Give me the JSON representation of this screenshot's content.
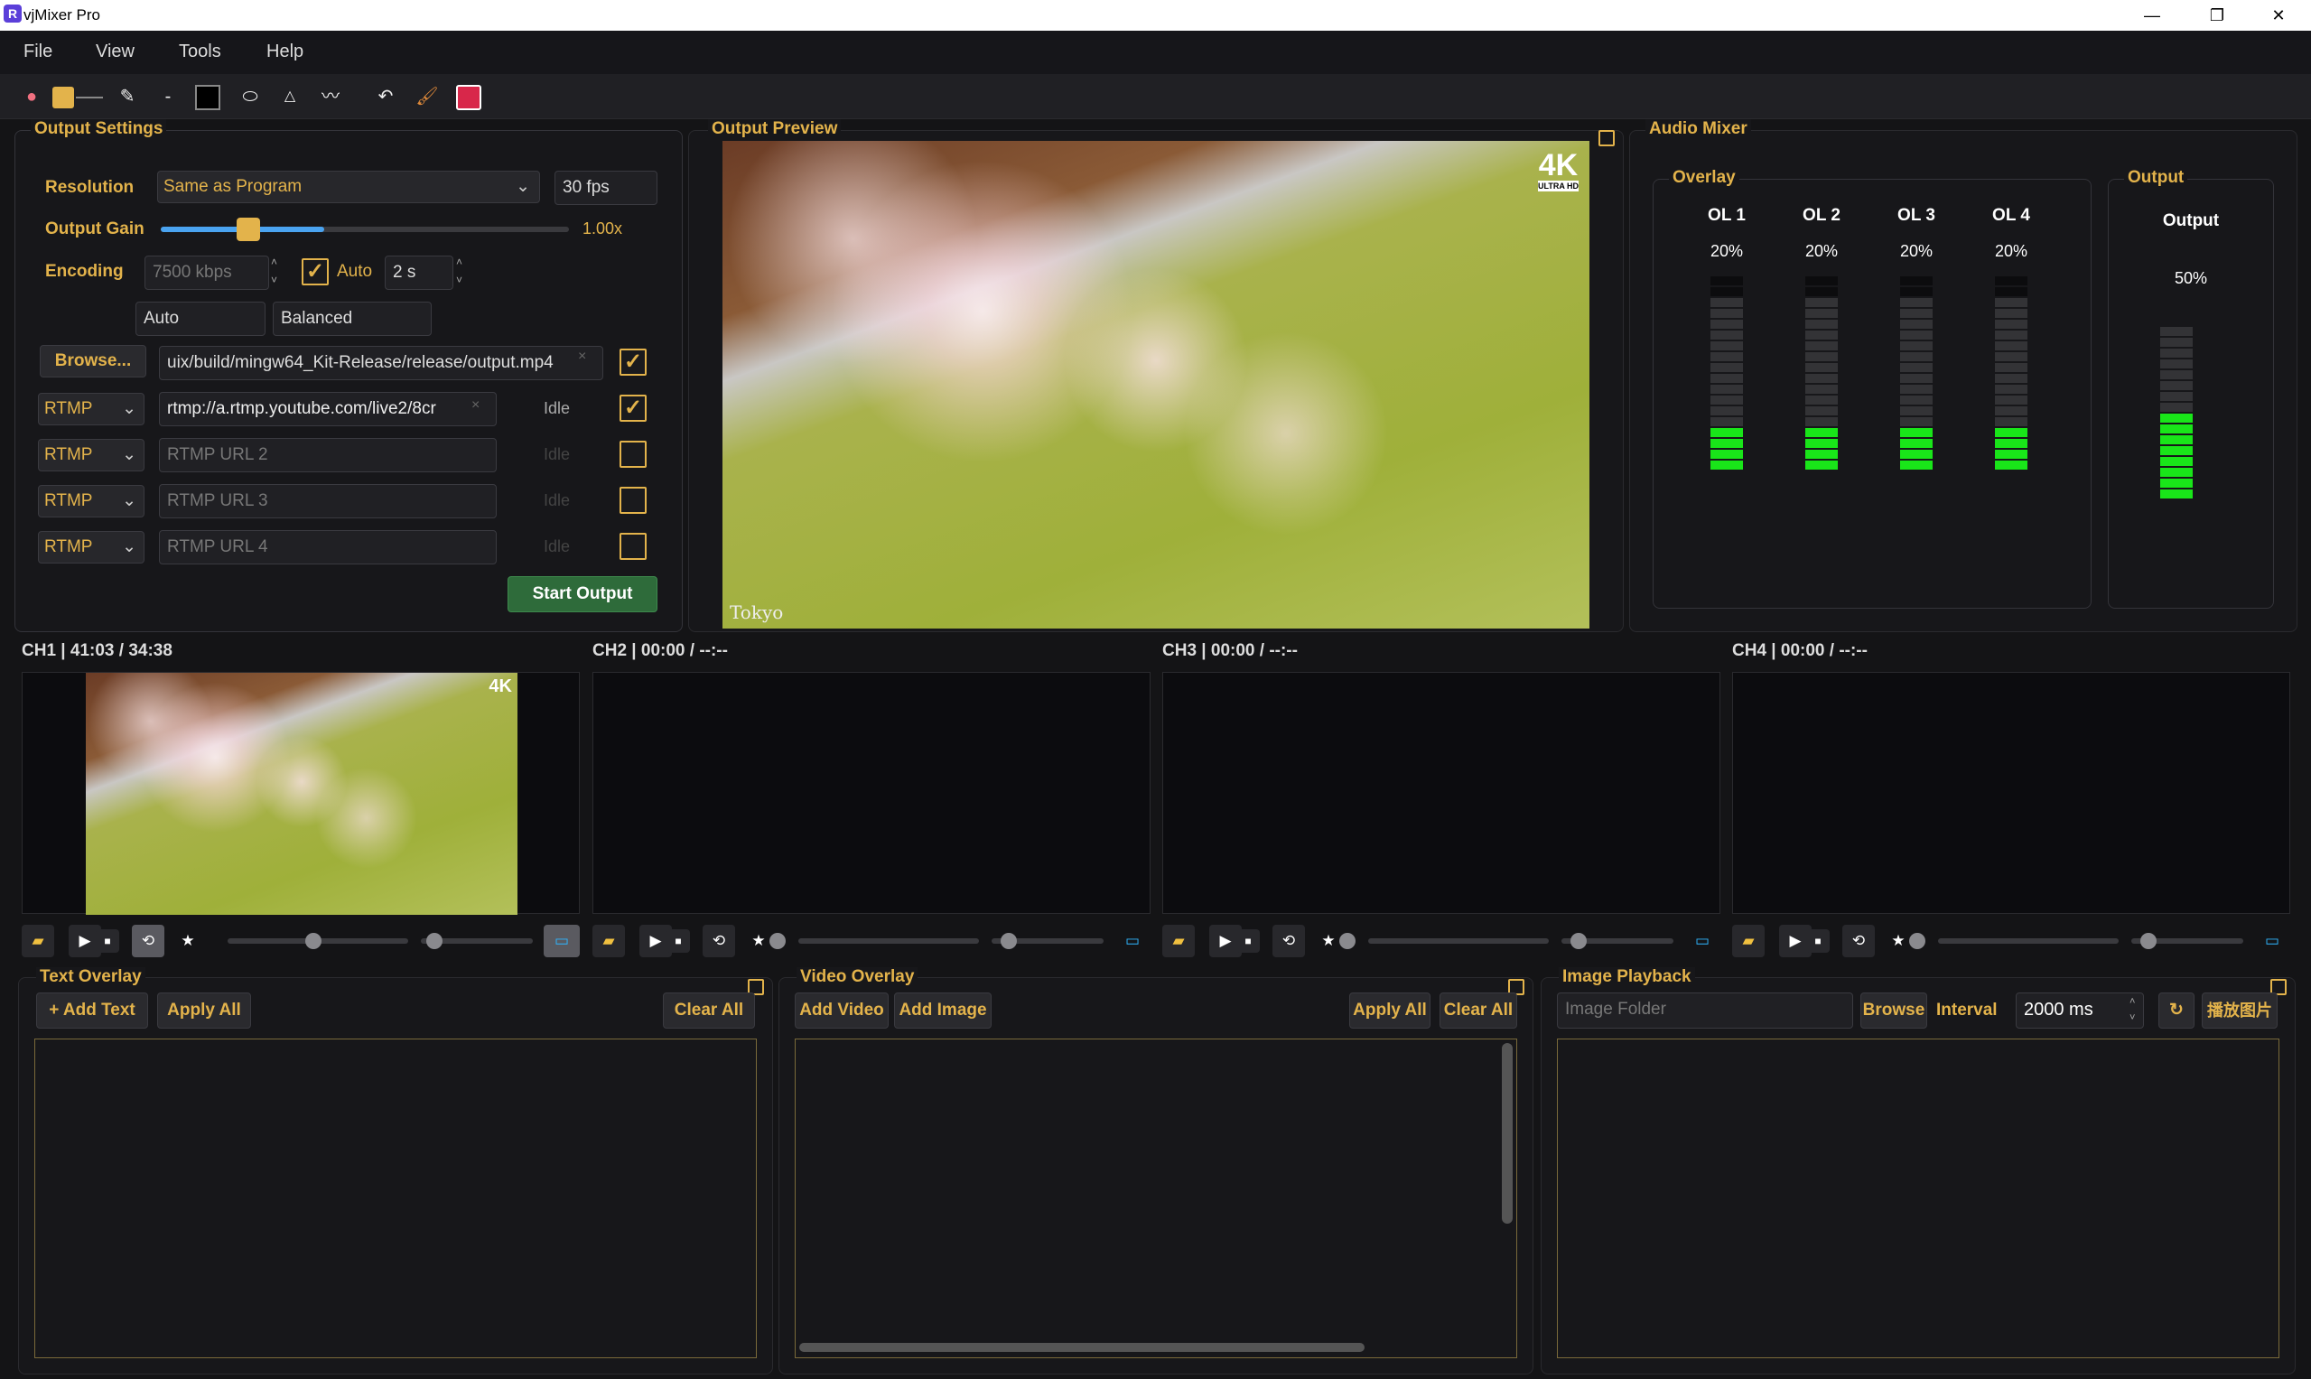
{
  "window": {
    "title": "vjMixer Pro",
    "controls": [
      "—",
      "❐",
      "✕"
    ]
  },
  "menu": [
    "File",
    "View",
    "Tools",
    "Help"
  ],
  "toolbar": {
    "icons": [
      "palette-icon",
      "color-swatch-icon",
      "pen-icon",
      "line-icon",
      "fill-square-icon",
      "ellipse-icon",
      "triangle-icon",
      "wave-icon",
      "undo-icon",
      "brush-icon",
      "save-icon"
    ]
  },
  "output_settings": {
    "title": "Output Settings",
    "resolution_label": "Resolution",
    "resolution_value": "Same as Program",
    "fps": "30 fps",
    "gain_label": "Output Gain",
    "gain_value": "1.00x",
    "gain_level": 0.4,
    "encoding_label": "Encoding",
    "bitrate": "7500 kbps",
    "auto_label": "Auto",
    "interval": "2 s",
    "preset1": "Auto",
    "preset2": "Balanced",
    "browse_label": "Browse...",
    "file_path": "uix/build/mingw64_Kit-Release/release/output.mp4",
    "rtmp_rows": [
      {
        "proto": "RTMP",
        "url": "rtmp://a.rtmp.youtube.com/live2/8cr",
        "placeholder": "",
        "status": "Idle",
        "checked": true
      },
      {
        "proto": "RTMP",
        "url": "",
        "placeholder": "RTMP URL 2",
        "status": "Idle",
        "checked": false
      },
      {
        "proto": "RTMP",
        "url": "",
        "placeholder": "RTMP URL 3",
        "status": "Idle",
        "checked": false
      },
      {
        "proto": "RTMP",
        "url": "",
        "placeholder": "RTMP URL 4",
        "status": "Idle",
        "checked": false
      }
    ],
    "start_label": "Start Output"
  },
  "preview": {
    "title": "Output Preview",
    "badge": "4K",
    "badge_sub": "ULTRA HD",
    "caption": "Tokyo"
  },
  "audio": {
    "title": "Audio Mixer",
    "overlay_title": "Overlay",
    "output_title": "Output",
    "channels": [
      {
        "name": "OL 1",
        "value": "20%"
      },
      {
        "name": "OL 2",
        "value": "20%"
      },
      {
        "name": "OL 3",
        "value": "20%"
      },
      {
        "name": "OL 4",
        "value": "20%"
      }
    ],
    "output": {
      "name": "Output",
      "value": "50%"
    }
  },
  "channels": [
    {
      "label": "CH1 | 41:03 / 34:38"
    },
    {
      "label": "CH2 | 00:00 / --:--"
    },
    {
      "label": "CH3 | 00:00 / --:--"
    },
    {
      "label": "CH4 | 00:00 / --:--"
    }
  ],
  "text_overlay": {
    "title": "Text Overlay",
    "add": "+ Add Text",
    "apply": "Apply All",
    "clear": "Clear All"
  },
  "video_overlay": {
    "title": "Video Overlay",
    "add_video": "Add Video",
    "add_image": "Add Image",
    "apply": "Apply All",
    "clear": "Clear All"
  },
  "image_playback": {
    "title": "Image Playback",
    "folder_placeholder": "Image Folder",
    "browse": "Browse",
    "interval_label": "Interval",
    "interval_value": "2000 ms",
    "play": "播放图片"
  }
}
